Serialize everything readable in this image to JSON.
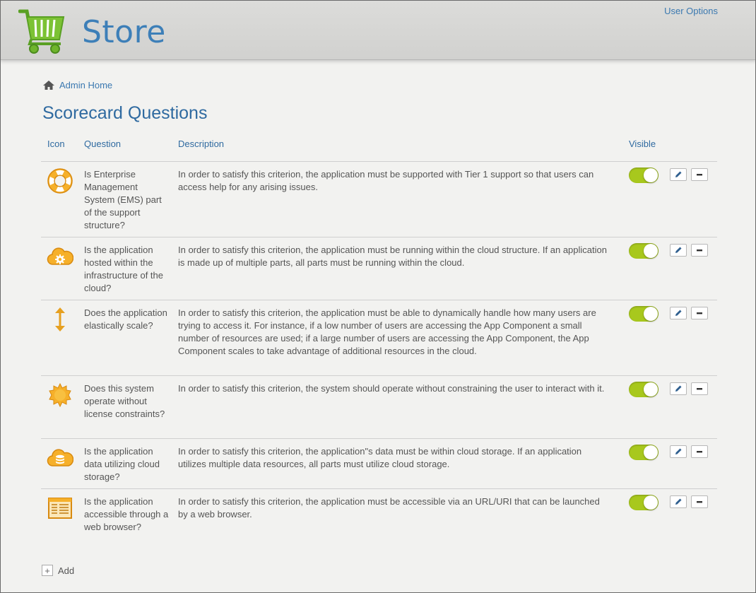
{
  "header": {
    "store_title": "Store",
    "user_options": "User Options"
  },
  "breadcrumb": {
    "home_label": "Admin Home"
  },
  "page": {
    "title": "Scorecard Questions"
  },
  "table": {
    "columns": {
      "icon": "Icon",
      "question": "Question",
      "description": "Description",
      "visible": "Visible"
    },
    "rows": [
      {
        "icon": "lifebuoy-icon",
        "question": "Is Enterprise Management System (EMS) part of the support structure?",
        "description": "In order to satisfy this criterion, the application must be supported with Tier 1 support so that users can access help for any arising issues.",
        "visible": true
      },
      {
        "icon": "cloud-gear-icon",
        "question": "Is the application hosted within the infrastructure of the cloud?",
        "description": "In order to satisfy this criterion, the application must be running within the cloud structure. If an application is made up of multiple parts, all parts must be running within the cloud.",
        "visible": true
      },
      {
        "icon": "vertical-arrows-icon",
        "question": "Does the application elastically scale?",
        "description": "In order to satisfy this criterion, the application must be able to dynamically handle how many users are trying to access it. For instance, if a low number of users are accessing the App Component a small number of resources are used; if a large number of users are accessing the App Component, the App Component scales to take advantage of additional resources in the cloud.",
        "visible": true
      },
      {
        "icon": "seal-badge-icon",
        "question": "Does this system operate without license constraints?",
        "description": "In order to satisfy this criterion, the system should operate without constraining the user to interact with it.",
        "visible": true
      },
      {
        "icon": "cloud-database-icon",
        "question": "Is the application data utilizing cloud storage?",
        "description": "In order to satisfy this criterion, the application\"s data must be within cloud storage. If an application utilizes multiple data resources, all parts must utilize cloud storage.",
        "visible": true
      },
      {
        "icon": "browser-window-icon",
        "question": "Is the application accessible through a web browser?",
        "description": "In order to satisfy this criterion, the application must be accessible via an URL/URI that can be launched by a web browser.",
        "visible": true
      }
    ]
  },
  "actions": {
    "add_label": "Add",
    "add_symbol": "+"
  },
  "colors": {
    "accent": "#3a78b0",
    "toggle_on": "#a8c81d",
    "icon_orange": "#f0a820",
    "cart_green": "#6fb52c"
  }
}
